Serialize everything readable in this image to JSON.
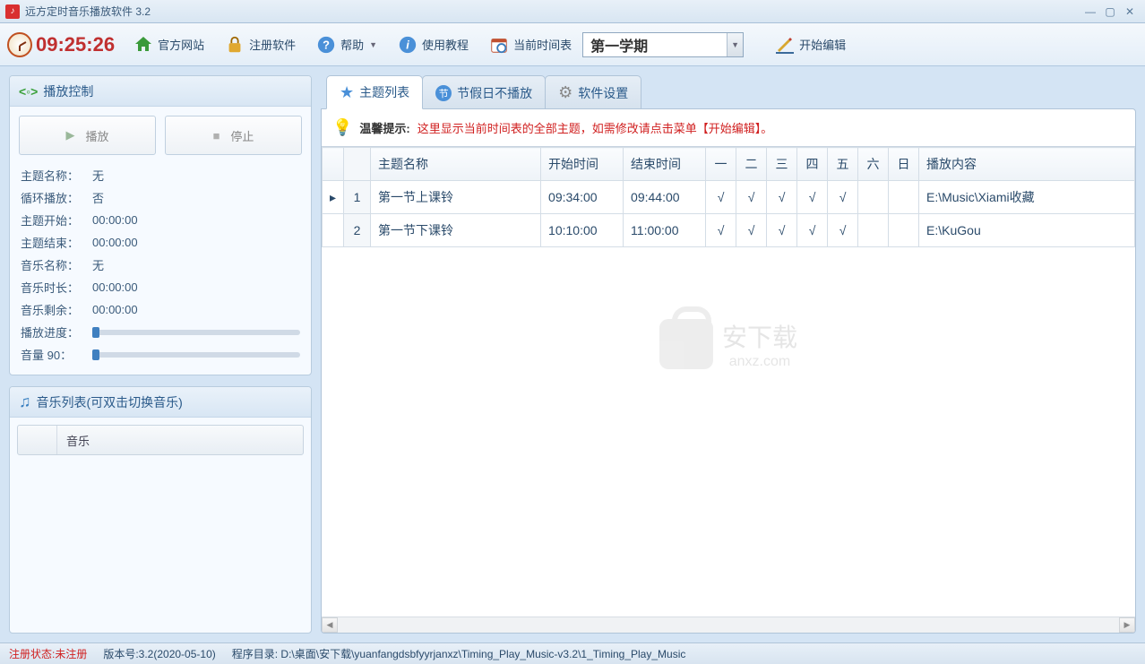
{
  "window": {
    "title": "远方定时音乐播放软件 3.2"
  },
  "toolbar": {
    "clock": "09:25:26",
    "website": "官方网站",
    "register": "注册软件",
    "help": "帮助",
    "tutorial": "使用教程",
    "schedule_label": "当前时间表",
    "schedule_value": "第一学期",
    "edit": "开始编辑"
  },
  "playback": {
    "title": "播放控制",
    "play": "播放",
    "stop": "停止",
    "rows": {
      "theme_name_lbl": "主题名称：",
      "theme_name_val": "无",
      "loop_lbl": "循环播放：",
      "loop_val": "否",
      "theme_start_lbl": "主题开始：",
      "theme_start_val": "00:00:00",
      "theme_end_lbl": "主题结束：",
      "theme_end_val": "00:00:00",
      "music_name_lbl": "音乐名称：",
      "music_name_val": "无",
      "music_len_lbl": "音乐时长：",
      "music_len_val": "00:00:00",
      "music_rem_lbl": "音乐剩余：",
      "music_rem_val": "00:00:00",
      "progress_lbl": "播放进度：",
      "volume_lbl": "音量 90："
    }
  },
  "musiclist": {
    "title": "音乐列表(可双击切换音乐)",
    "col": "音乐"
  },
  "tabs": {
    "themes": "主题列表",
    "holidays": "节假日不播放",
    "settings": "软件设置"
  },
  "hint": {
    "prefix": "温馨提示:",
    "body": "这里显示当前时间表的全部主题，如需修改请点击菜单【开始编辑】。"
  },
  "grid": {
    "cols": {
      "name": "主题名称",
      "start": "开始时间",
      "end": "结束时间",
      "d1": "一",
      "d2": "二",
      "d3": "三",
      "d4": "四",
      "d5": "五",
      "d6": "六",
      "d7": "日",
      "content": "播放内容"
    },
    "rows": [
      {
        "n": "1",
        "name": "第一节上课铃",
        "start": "09:34:00",
        "end": "09:44:00",
        "d": [
          "√",
          "√",
          "√",
          "√",
          "√",
          "",
          ""
        ],
        "content": "E:\\Music\\Xiami收藏"
      },
      {
        "n": "2",
        "name": "第一节下课铃",
        "start": "10:10:00",
        "end": "11:00:00",
        "d": [
          "√",
          "√",
          "√",
          "√",
          "√",
          "",
          ""
        ],
        "content": "E:\\KuGou"
      }
    ]
  },
  "watermark": {
    "text1": "安下载",
    "text2": "anxz.com"
  },
  "status": {
    "reg": "注册状态:未注册",
    "ver": "版本号:3.2(2020-05-10)",
    "dir": "程序目录: D:\\桌面\\安下载\\yuanfangdsbfyyrjanxz\\Timing_Play_Music-v3.2\\1_Timing_Play_Music"
  }
}
